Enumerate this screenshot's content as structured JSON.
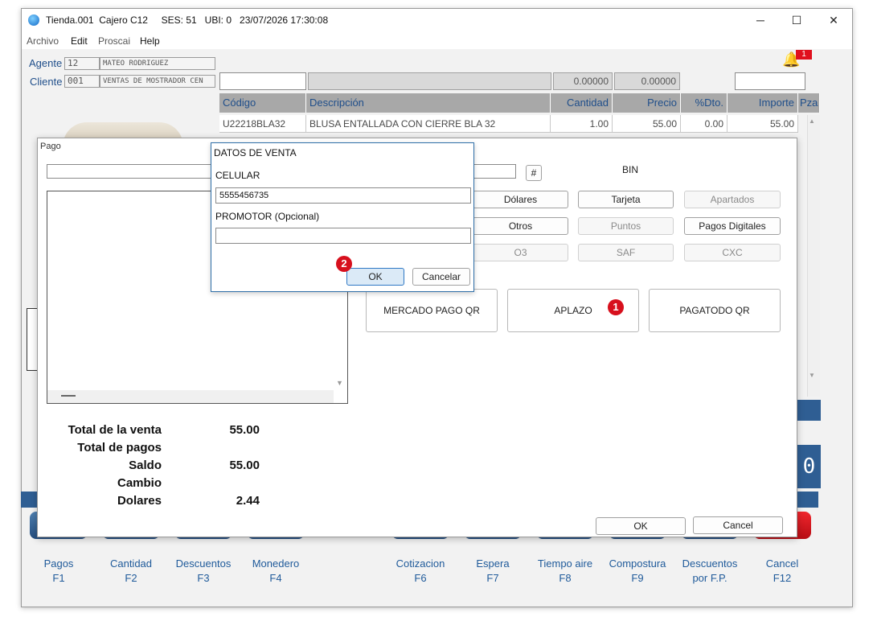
{
  "window": {
    "title": "Tienda.001  Cajero C12     SES: 51   UBI: 0   23/07/2026 17:30:08"
  },
  "menu": [
    "Archivo",
    "Edit",
    "Proscai",
    "Help"
  ],
  "notification": {
    "count": "1"
  },
  "agente": {
    "label": "Agente",
    "code": "12",
    "name": "MATEO RODRIGUEZ"
  },
  "cliente": {
    "label": "Cliente",
    "code": "001",
    "name": "VENTAS DE MOSTRADOR CEN"
  },
  "totals_row": {
    "qty": "0.00000",
    "price": "0.00000"
  },
  "table": {
    "headers": [
      "Código",
      "Descripción",
      "Cantidad",
      "Precio",
      "%Dto.",
      "Importe",
      "Pza"
    ],
    "rows": [
      [
        "U22218BLA32",
        "BLUSA ENTALLADA CON CIERRE BLA 32",
        "1.00",
        "55.00",
        "0.00",
        "55.00"
      ]
    ]
  },
  "pago": {
    "title": "Pago",
    "hash_button": "#",
    "bin_label": "BIN",
    "methods_row1": [
      "Dólares",
      "Tarjeta",
      "Apartados"
    ],
    "methods_row2": [
      "Otros",
      "Puntos",
      "Pagos Digitales"
    ],
    "methods_row3": [
      "O3",
      "SAF",
      "CXC"
    ],
    "big_buttons": [
      "MERCADO PAGO QR",
      "APLAZO",
      "PAGATODO QR"
    ],
    "totals": [
      {
        "label": "Total de la venta",
        "value": "55.00"
      },
      {
        "label": "Total de pagos",
        "value": ""
      },
      {
        "label": "Saldo",
        "value": "55.00"
      },
      {
        "label": "Cambio",
        "value": ""
      },
      {
        "label": "Dolares",
        "value": "2.44"
      }
    ],
    "ok": "OK",
    "cancel": "Cancel"
  },
  "datos_venta": {
    "title": "DATOS DE VENTA",
    "celular_label": "CELULAR",
    "celular_value": "5555456735",
    "promotor_label": "PROMOTOR (Opcional)",
    "promotor_value": "",
    "ok": "OK",
    "cancel": "Cancelar"
  },
  "step_badges": [
    "1",
    "2"
  ],
  "function_keys": [
    {
      "label": "Pagos",
      "key": "F1"
    },
    {
      "label": "Cantidad",
      "key": "F2"
    },
    {
      "label": "Descuentos",
      "key": "F3"
    },
    {
      "label": "Monedero",
      "key": "F4"
    },
    {
      "label": "Cotizacion",
      "key": "F6"
    },
    {
      "label": "Espera",
      "key": "F7"
    },
    {
      "label": "Tiempo aire",
      "key": "F8"
    },
    {
      "label": "Compostura",
      "key": "F9"
    },
    {
      "label": "Descuentos",
      "key": "por F.P."
    },
    {
      "label": "Cancel",
      "key": "F12"
    }
  ],
  "colors": {
    "accent": "#1f4e8a",
    "badge": "#d7101d",
    "cancel_key": "#d7101d"
  }
}
